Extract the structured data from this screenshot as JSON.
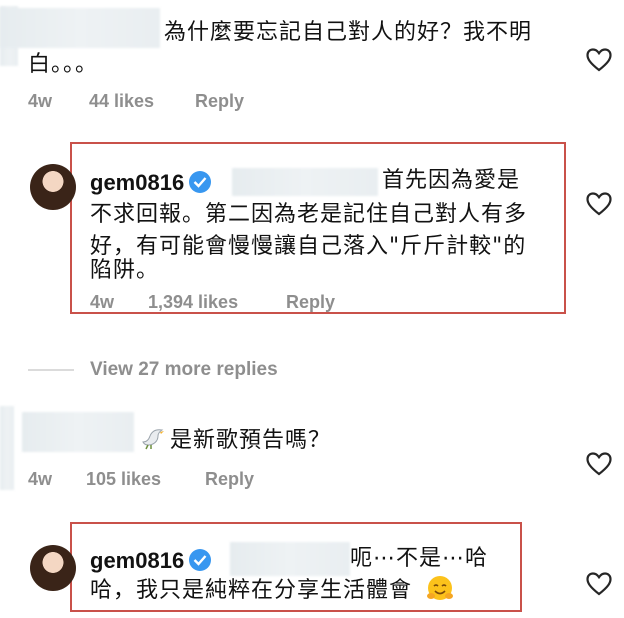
{
  "comments": [
    {
      "text_line1": "為什麼要忘記自己對人的好？我不明",
      "text_line2": "白。。。",
      "age": "4w",
      "likes": "44 likes",
      "reply_label": "Reply"
    },
    {
      "username": "gem0816",
      "text_line1": "首先因為愛是",
      "text_line2": "不求回報。第二因為老是記住自己對人有多",
      "text_line3": "好，有可能會慢慢讓自己落入\"斤斤計較\"的",
      "text_line4": "陷阱。",
      "age": "4w",
      "likes": "1,394 likes",
      "reply_label": "Reply"
    },
    {
      "text_line1": "是新歌預告嗎？",
      "age": "4w",
      "likes": "105 likes",
      "reply_label": "Reply"
    },
    {
      "username": "gem0816",
      "text_line1": "呃⋯不是⋯哈",
      "text_line2": "哈，我只是純粹在分享生活體會"
    }
  ],
  "view_more": "View 27 more replies",
  "colors": {
    "highlight": "#c9514a",
    "verified": "#3897f0",
    "meta": "#8e8e8e"
  },
  "icons": [
    "heart-icon",
    "verified-badge-icon",
    "dove-emoji-icon",
    "hugging-face-emoji-icon"
  ]
}
